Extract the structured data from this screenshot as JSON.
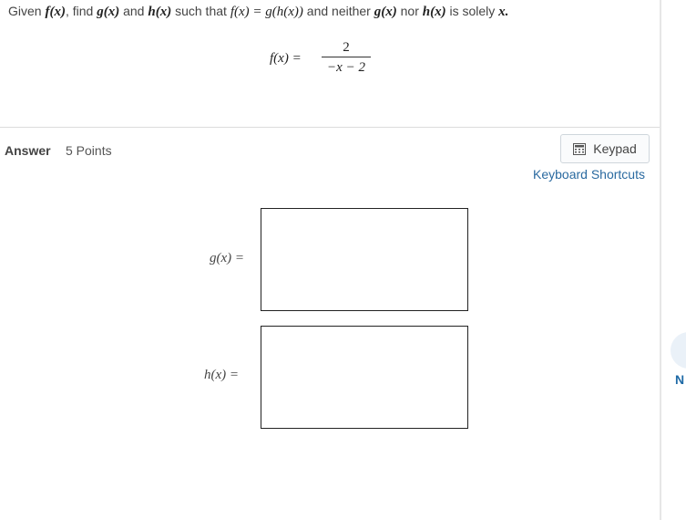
{
  "question": {
    "given": "Given",
    "f_of_x": "f(x)",
    "find": ", find",
    "g_of_x": "g(x)",
    "and_word": "and",
    "h_of_x": "h(x)",
    "such_that": "such that",
    "relation": "f(x) = g(h(x))",
    "and_neither": "and neither",
    "nor_word": "nor",
    "is_solely": "is solely",
    "x_var": "x."
  },
  "formula": {
    "lhs": "f(x) =",
    "numerator": "2",
    "denominator": "−x − 2"
  },
  "answer": {
    "label": "Answer",
    "points": "5 Points",
    "keypad_label": "Keypad",
    "keypad_icon": "calculator-icon",
    "shortcuts_label": "Keyboard Shortcuts"
  },
  "fields": {
    "g_label": "g(x) =",
    "h_label": "h(x) =",
    "g_value": "",
    "h_value": ""
  },
  "side": {
    "next_label": "N"
  },
  "colors": {
    "link": "#2a6aa0",
    "divider": "#dcdcdc",
    "next_bubble": "#eaf1f8"
  }
}
